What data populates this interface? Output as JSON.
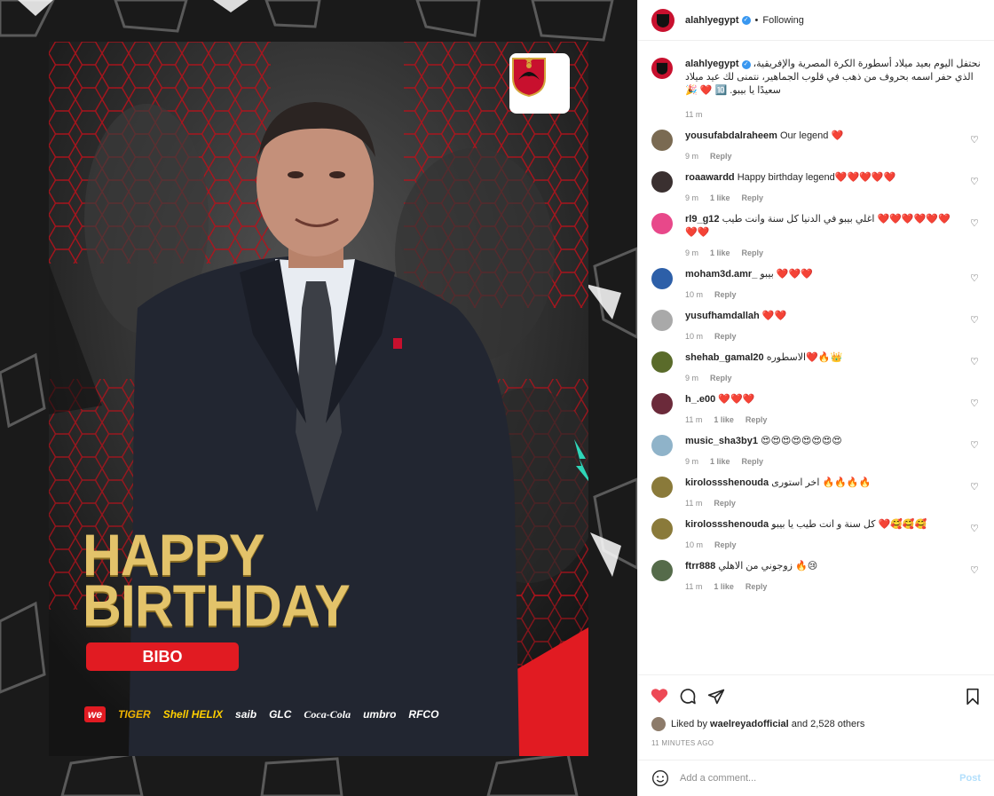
{
  "post": {
    "headline_1": "HAPPY",
    "headline_2": "BIRTHDAY",
    "name": "BIBO",
    "sponsors": [
      "we",
      "TIGER",
      "Shell HELIX",
      "saib",
      "GLC",
      "Coca-Cola",
      "umbro",
      "RFCO"
    ]
  },
  "header": {
    "username": "alahlyegypt",
    "separator": "•",
    "following": "Following"
  },
  "caption": {
    "username": "alahlyegypt",
    "line1": "نحتفل اليوم بعيد ميلاد أسطورة الكرة المصرية والإفريقية،",
    "line2": "الذي حفر اسمه بحروف من ذهب في قلوب الجماهير، نتمنى لك عيد ميلاد",
    "line3": "سعيدًا يا بيبو. 🔟 ❤️ 🎉",
    "time": "11 m"
  },
  "comments": [
    {
      "user": "yousufabdalraheem",
      "text": "Our legend ❤️",
      "time": "9 m",
      "likes": "",
      "reply": "Reply",
      "color": "#7a6a52"
    },
    {
      "user": "roaawardd",
      "text": "Happy birthday legend❤️❤️❤️❤️❤️",
      "time": "9 m",
      "likes": "1 like",
      "reply": "Reply",
      "color": "#3a3030"
    },
    {
      "user": "rl9_g12",
      "text": "اغلي بيبو في الدنيا كل سنة وانت طيب ❤️❤️❤️❤️❤️❤️❤️❤️",
      "time": "9 m",
      "likes": "1 like",
      "reply": "Reply",
      "color": "#e8488a"
    },
    {
      "user": "moham3d.amr_",
      "text": "بيبو ❤️❤️❤️",
      "time": "10 m",
      "likes": "",
      "reply": "Reply",
      "color": "#2d5fa8"
    },
    {
      "user": "yusufhamdallah",
      "text": "❤️❤️",
      "time": "10 m",
      "likes": "",
      "reply": "Reply",
      "color": "#a9a9a9"
    },
    {
      "user": "shehab_gamal20",
      "text": "الاسطوره❤️🔥👑",
      "time": "9 m",
      "likes": "",
      "reply": "Reply",
      "color": "#5a6b2a"
    },
    {
      "user": "h_.e00",
      "text": "❤️❤️❤️",
      "time": "11 m",
      "likes": "1 like",
      "reply": "Reply",
      "color": "#6b2a3a"
    },
    {
      "user": "music_sha3by1",
      "text": "😍😍😍😍😍😍😍😍",
      "time": "9 m",
      "likes": "1 like",
      "reply": "Reply",
      "color": "#8fb3c9"
    },
    {
      "user": "kirolossshenouda",
      "text": "اخر استورى 🔥🔥🔥🔥",
      "time": "11 m",
      "likes": "",
      "reply": "Reply",
      "color": "#8a7a3a"
    },
    {
      "user": "kirolossshenouda",
      "text": "كل سنة و انت طيب يا بيبو ❤️🥰🥰🥰",
      "time": "10 m",
      "likes": "",
      "reply": "Reply",
      "color": "#8a7a3a"
    },
    {
      "user": "ftrr888",
      "text": "زوجوني من الاهلي 🔥😢",
      "time": "11 m",
      "likes": "1 like",
      "reply": "Reply",
      "color": "#556b4a"
    }
  ],
  "footer": {
    "liked_by_prefix": "Liked by",
    "liked_by_user": "wael reyadofficial",
    "liked_by_user_display": "waelreyadofficial",
    "liked_by_suffix": "and 2,528 others",
    "timestamp": "11 MINUTES AGO",
    "comment_placeholder": "Add a comment...",
    "post_label": "Post"
  },
  "colors": {
    "accent_red": "#e11b22",
    "gold": "#e3c36a",
    "verified": "#3897f0",
    "muted": "#8e8e8e"
  }
}
